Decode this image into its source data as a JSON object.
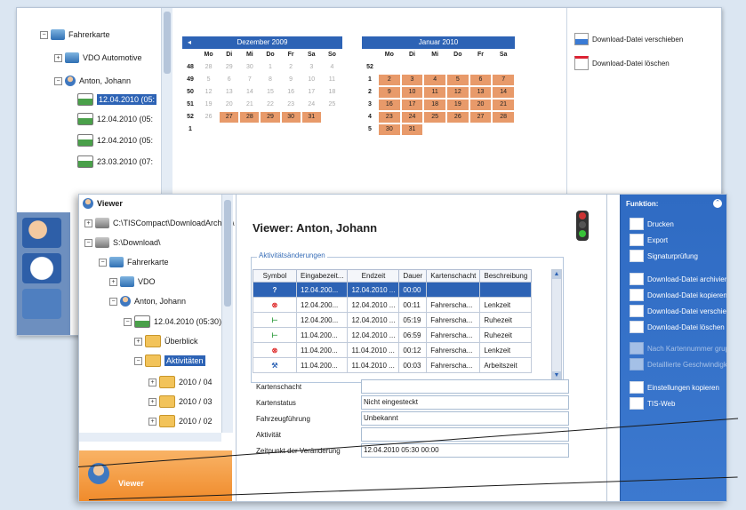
{
  "back": {
    "tree": {
      "fahrerkarte": "Fahrerkarte",
      "vdo": "VDO Automotive",
      "driver": "Anton, Johann",
      "dates": [
        "12.04.2010 (05:",
        "12.04.2010 (05:",
        "12.04.2010 (05:",
        "23.03.2010 (07:"
      ]
    },
    "calendar_dec": {
      "title": "Dezember 2009",
      "weekdays": [
        "Mo",
        "Di",
        "Mi",
        "Do",
        "Fr",
        "Sa",
        "So"
      ],
      "rows": [
        {
          "cw": "48",
          "days": [
            "28",
            "29",
            "30",
            "1",
            "2",
            "3",
            "4"
          ]
        },
        {
          "cw": "49",
          "days": [
            "5",
            "6",
            "7",
            "8",
            "9",
            "10",
            "11"
          ]
        },
        {
          "cw": "50",
          "days": [
            "12",
            "13",
            "14",
            "15",
            "16",
            "17",
            "18"
          ]
        },
        {
          "cw": "51",
          "days": [
            "19",
            "20",
            "21",
            "22",
            "23",
            "24",
            "25"
          ]
        },
        {
          "cw": "52",
          "days": [
            "26",
            "27",
            "28",
            "29",
            "30",
            "31",
            ""
          ]
        },
        {
          "cw": "1",
          "days": [
            "",
            "",
            "",
            "",
            "",
            "",
            ""
          ]
        }
      ]
    },
    "calendar_jan": {
      "title": "Januar 2010",
      "weekdays": [
        "Mo",
        "Di",
        "Mi",
        "Do",
        "Fr",
        "Sa"
      ],
      "rows": [
        {
          "cw": "52",
          "days": [
            "",
            "",
            "",
            "",
            "",
            ""
          ]
        },
        {
          "cw": "1",
          "days": [
            "2",
            "3",
            "4",
            "5",
            "6",
            "7"
          ]
        },
        {
          "cw": "2",
          "days": [
            "9",
            "10",
            "11",
            "12",
            "13",
            "14"
          ]
        },
        {
          "cw": "3",
          "days": [
            "16",
            "17",
            "18",
            "19",
            "20",
            "21"
          ]
        },
        {
          "cw": "4",
          "days": [
            "23",
            "24",
            "25",
            "26",
            "27",
            "28"
          ]
        },
        {
          "cw": "5",
          "days": [
            "30",
            "31",
            "",
            "",
            "",
            ""
          ]
        }
      ]
    },
    "functions": [
      "Download-Datei verschieben",
      "Download-Datei löschen"
    ]
  },
  "front": {
    "tree": {
      "root": "Viewer",
      "path1": "C:\\TISCompact\\DownloadArchive\\",
      "path2": "S:\\Download\\",
      "fahrerkarte": "Fahrerkarte",
      "vdo": "VDO",
      "driver": "Anton, Johann",
      "date": "12.04.2010 (05:30)",
      "ueberblick": "Überblick",
      "aktivitaeten": "Aktivitäten",
      "months": [
        "2010 / 04",
        "2010 / 03",
        "2010 / 02"
      ]
    },
    "viewer_button": "Viewer",
    "title": "Viewer: Anton, Johann",
    "group_title": "Aktivitätsänderungen",
    "columns": [
      "Symbol",
      "Eingabezeit...",
      "Endzeit",
      "Dauer",
      "Kartenschacht",
      "Beschreibung"
    ],
    "rows": [
      {
        "symbol": "?",
        "start": "12.04.200...",
        "end": "12.04.2010 ...",
        "dur": "00:00",
        "slot": "",
        "desc": ""
      },
      {
        "symbol": "⊗",
        "start": "12.04.200...",
        "end": "12.04.2010 ...",
        "dur": "00:11",
        "slot": "Fahrerscha...",
        "desc": "Lenkzeit"
      },
      {
        "symbol": "⊢",
        "start": "12.04.200...",
        "end": "12.04.2010 ...",
        "dur": "05:19",
        "slot": "Fahrerscha...",
        "desc": "Ruhezeit"
      },
      {
        "symbol": "⊢",
        "start": "11.04.200...",
        "end": "12.04.2010 ...",
        "dur": "06:59",
        "slot": "Fahrerscha...",
        "desc": "Ruhezeit"
      },
      {
        "symbol": "⊗",
        "start": "11.04.200...",
        "end": "11.04.2010 ...",
        "dur": "00:12",
        "slot": "Fahrerscha...",
        "desc": "Lenkzeit"
      },
      {
        "symbol": "⚒",
        "start": "11.04.200...",
        "end": "11.04.2010 ...",
        "dur": "00:03",
        "slot": "Fahrerscha...",
        "desc": "Arbeitszeit"
      }
    ],
    "details": [
      {
        "label": "Kartenschacht",
        "value": ""
      },
      {
        "label": "Kartenstatus",
        "value": "Nicht eingesteckt"
      },
      {
        "label": "Fahrzeugführung",
        "value": "Unbekannt"
      },
      {
        "label": "Aktivität",
        "value": ""
      },
      {
        "label": "Zeitpunkt der Veränderung",
        "value": "12.04.2010 05:30                    00:00"
      }
    ],
    "functions_title": "Funktion:",
    "functions": [
      {
        "label": "Drucken",
        "disabled": false
      },
      {
        "label": "Export",
        "disabled": false
      },
      {
        "label": "Signaturprüfung",
        "disabled": false
      },
      {
        "label": "Download-Datei archivieren",
        "disabled": false
      },
      {
        "label": "Download-Datei kopieren",
        "disabled": false
      },
      {
        "label": "Download-Datei verschieben",
        "disabled": false
      },
      {
        "label": "Download-Datei löschen",
        "disabled": false
      },
      {
        "label": "Nach Kartennummer gruppi...",
        "disabled": true
      },
      {
        "label": "Detaillierte Geschwindigkeit",
        "disabled": true
      },
      {
        "label": "Einstellungen kopieren",
        "disabled": false
      },
      {
        "label": "TIS-Web",
        "disabled": false
      }
    ]
  },
  "colors": {
    "accent": "#2d63b5",
    "highlight_day": "#e89a6a",
    "viewer_orange": "#f08b2b"
  }
}
